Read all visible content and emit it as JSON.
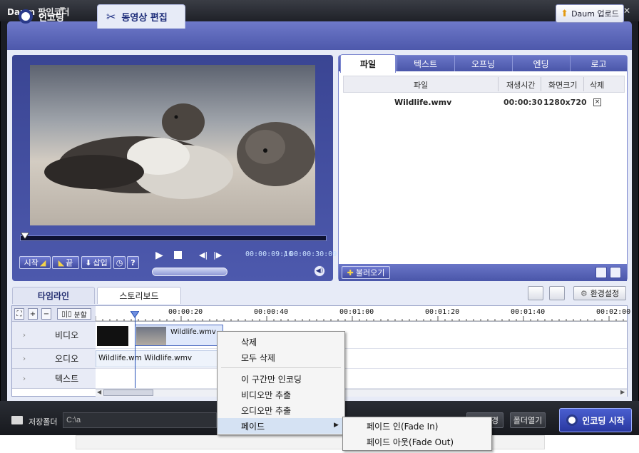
{
  "app": {
    "title": "Daum 팟인코더"
  },
  "tabs": {
    "encoding": "인코딩",
    "editing": "동영상 편집"
  },
  "header": {
    "upload_label": "Daum 업로드"
  },
  "player": {
    "start_label": "시작",
    "end_label": "끝",
    "insert_label": "삽입",
    "help_label": "?",
    "time_current": "00:00:09:16",
    "time_sep": "/",
    "time_total": "00:00:30:09"
  },
  "file_panel": {
    "tabs": [
      "파일",
      "텍스트",
      "오프닝",
      "엔딩",
      "로고"
    ],
    "columns": [
      "파일",
      "재생시간",
      "화면크기",
      "삭제"
    ],
    "rows": [
      {
        "name": "Wildlife.wmv",
        "duration": "00:00:30",
        "size": "1280x720",
        "delete": "×"
      }
    ],
    "load_label": "불러오기"
  },
  "timeline": {
    "tabs": [
      "타임라인",
      "스토리보드"
    ],
    "settings_label": "환경설정",
    "split_label": "분할",
    "ruler": [
      "00:00:20",
      "00:00:40",
      "00:01:00",
      "00:01:20",
      "00:01:40",
      "00:02:00"
    ],
    "tracks": [
      "비디오",
      "오디오",
      "텍스트"
    ],
    "video_clip_label": "Wildlife.wmv",
    "audio_clip_label": "Wildlife.wm Wildlife.wmv"
  },
  "context_menu": {
    "items": [
      "삭제",
      "모두 삭제",
      "이 구간만 인코딩",
      "비디오만 추출",
      "오디오만 추출",
      "페이드"
    ],
    "submenu": [
      "페이드 인(Fade In)",
      "페이드 아웃(Fade Out)"
    ]
  },
  "bottom": {
    "save_folder_label": "저장폴더",
    "path_value": "C:\\a",
    "change_label": "경",
    "open_folder_label": "폴더열기",
    "start_encoding_label": "인코딩 시작"
  }
}
